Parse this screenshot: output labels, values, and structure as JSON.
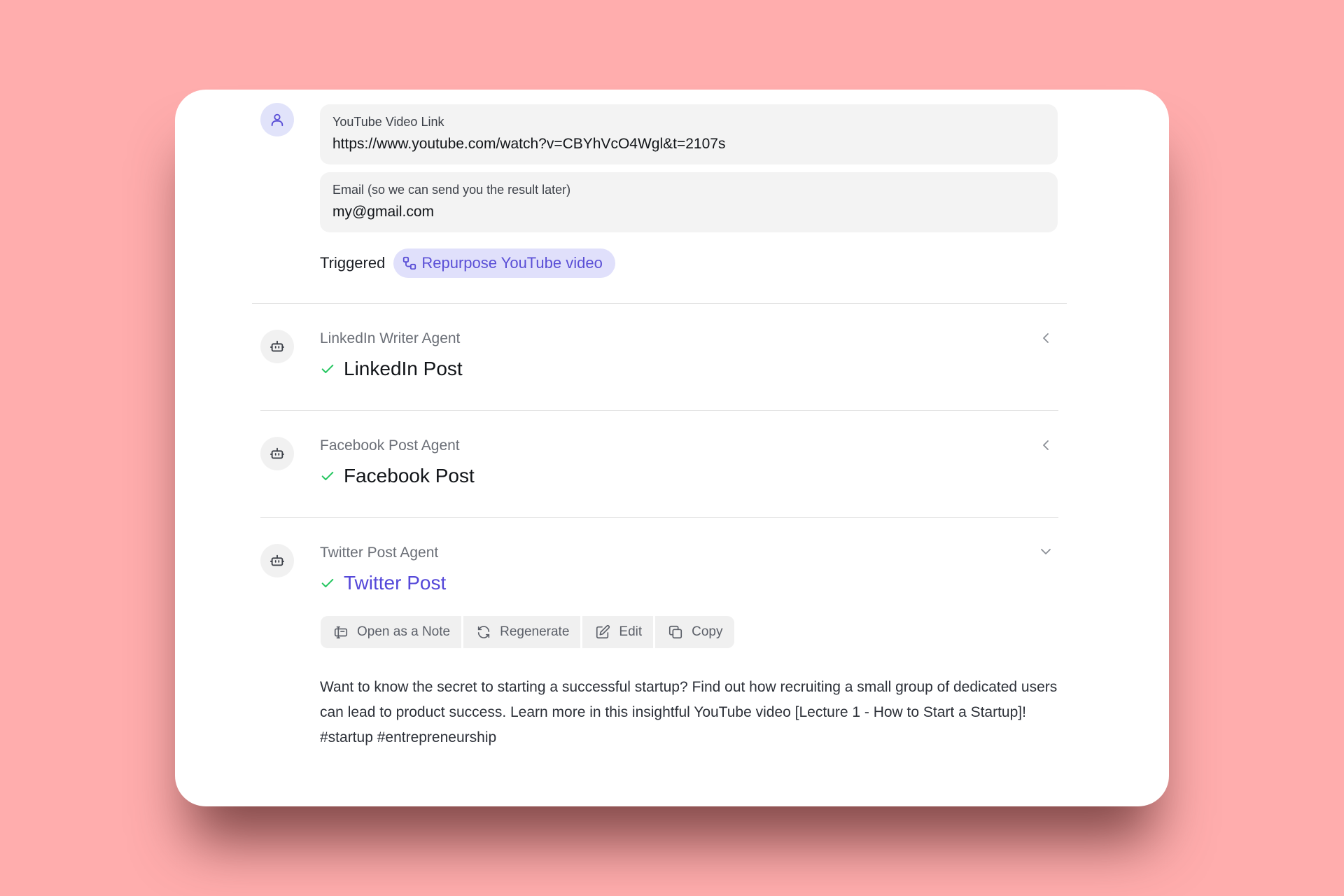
{
  "input": {
    "youtube_field": {
      "label": "YouTube Video Link",
      "value": "https://www.youtube.com/watch?v=CBYhVcO4Wgl&t=2107s"
    },
    "email_field": {
      "label": "Email (so we can send you the result later)",
      "value": "my@gmail.com"
    },
    "triggered_label": "Triggered",
    "trigger_chip": "Repurpose YouTube video"
  },
  "agents": [
    {
      "name": "LinkedIn Writer Agent",
      "title": "LinkedIn Post",
      "status": "done",
      "expanded": false
    },
    {
      "name": "Facebook Post Agent",
      "title": "Facebook Post",
      "status": "done",
      "expanded": false
    },
    {
      "name": "Twitter Post Agent",
      "title": "Twitter Post",
      "status": "done",
      "expanded": true
    }
  ],
  "toolbar": {
    "open_note": "Open as a Note",
    "regenerate": "Regenerate",
    "edit": "Edit",
    "copy": "Copy"
  },
  "result": {
    "text": "Want to know the secret to starting a successful startup? Find out how recruiting a small group of dedicated users can lead to product success. Learn more in this insightful YouTube video [Lecture 1 - How to Start a Startup]! #startup #entrepreneurship"
  },
  "colors": {
    "background": "#ffadad",
    "accent": "#5548d9",
    "check": "#22c55e"
  },
  "icons": [
    "user-icon",
    "workflow-icon",
    "robot-icon",
    "check-icon",
    "chevron-left-icon",
    "chevron-down-icon",
    "note-icon",
    "refresh-icon",
    "edit-icon",
    "copy-icon"
  ]
}
